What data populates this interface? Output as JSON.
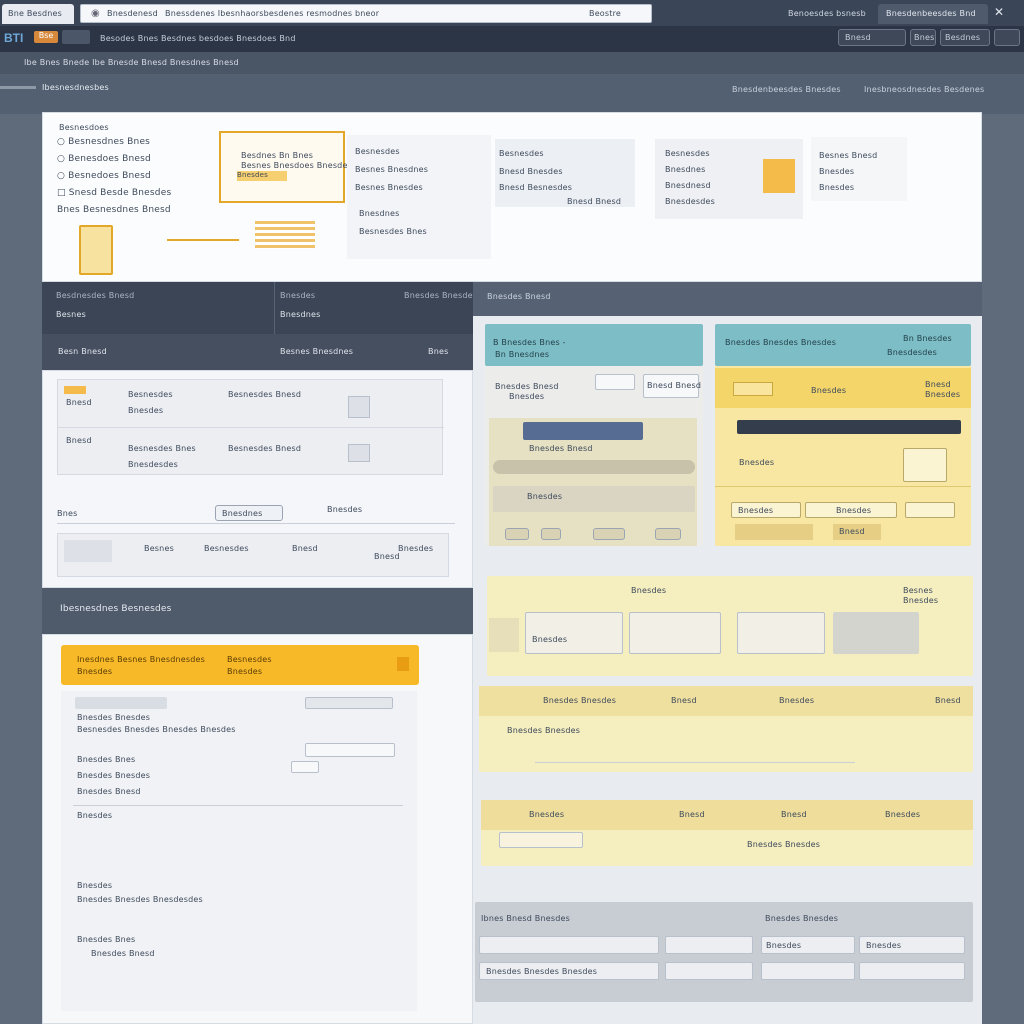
{
  "browser": {
    "tab1": "Bne Besdnes",
    "tab2": "Bnesdenesd",
    "address": "Bnessdenes Ibesnhaorsbesdenes resmodnes bneor",
    "address_btn": "Beostre",
    "right_tab": "Benoesdes bsnesb",
    "right_tab2": "Bnesdenbeesdes Bnd"
  },
  "menu": {
    "logo": "BTI",
    "badge": "Bse",
    "items": "Besodes Bnes Besdnes besdoes Bnesdoes Bnd",
    "right_btn1": "Bnesd",
    "right_btn2": "Bnes",
    "right_btn3": "Besdnes"
  },
  "subbar": {
    "text": "Ibe Bnes Bnede Ibe Bnesde Bnesd Bnesdnes Bnesd"
  },
  "pagebar": {
    "title": "Ibesnesdnesbes",
    "right1": "Bnesdenbeesdes Bnesdes",
    "right2": "Inesbneosdnesdes Besdenes"
  },
  "hero": {
    "list_title": "Besnesdoes",
    "list": [
      "Besnesdnes Bnes",
      "Benesdoes Bnesd",
      "Besnedoes Bnesd",
      "Snesd Besde Bnesdes",
      "Bnes Besnesdnes Bnesd"
    ],
    "callout": [
      "Besdnes Bn Bnes",
      "Besnes Bnesdoes Bnesdes",
      "Bnesdes"
    ],
    "cols": [
      {
        "h": "Besnesdes",
        "rows": [
          "Besnes Bnesdnes",
          "Besnes Bnesdes",
          "Bnesdnes",
          "Besnesdes Bnes"
        ]
      },
      {
        "h": "Besnesdes",
        "rows": [
          "Bnesd Bnesdes",
          "Bnesd Besnesdes",
          "Bnesd Bnesd"
        ]
      },
      {
        "h": "Besnesdes",
        "rows": [
          "Bnesdnes",
          "Bnesdnesd",
          "Bnesdesdes"
        ]
      },
      {
        "h": "Besnes Bnesd",
        "rows": [
          "Bnesdes",
          "Bnesdes"
        ]
      }
    ]
  },
  "left": {
    "table_head": [
      "Besdnesdes Bnesd",
      "Bnesdes",
      "Bnesdes Bnesdes"
    ],
    "table_row1": [
      "Besnes",
      "Bnesdnes"
    ],
    "table_row2": [
      "Besn Bnesd",
      "Besnes Bnesdnes",
      "Bnes"
    ],
    "list_rows": [
      [
        "Bnesd",
        "Besnesdes",
        "Bnesdes"
      ],
      [
        "Bnesd",
        "Besnesdes Bnesd",
        "Bnesdes"
      ],
      [
        "Bnesd",
        "Besnesdes Bnes",
        "Bnesdesdes"
      ],
      [
        "Bnesd",
        "Besnesdes Bnesd",
        "Bnesdes"
      ]
    ],
    "pager_label": "Bnes",
    "pager_btn": "Bnesdnes",
    "pager_right": "Bnesdes",
    "summary": [
      "Besnes",
      "Bnesd",
      "Besnesdes",
      "Bnesd",
      "Bnesdes"
    ],
    "section_title": "Ibesnesdnes Besnesdes",
    "alert_title": "Inesdnes Besnes Bnesdnesdes",
    "alert_sub": "Bnesdes",
    "alert_right": "Besnesdes",
    "alert_right2": "Bnesdes",
    "form_rows": [
      "Bnesdes Bnesdes",
      "Besnesdes Bnesdes Bnesdes Bnesdes",
      "Bnesdes Bnes",
      "Bnesdes Bnesdes",
      "Bnesdes Bnesd",
      "Bnesdes",
      "Bnesdes",
      "Bnesdes Bnesdes Bnesdesdes",
      "Bnesdes Bnes",
      "Bnesdes Bnesd"
    ]
  },
  "right": {
    "header": "Bnesdes Bnesd",
    "teal1_title": "B Bnesdes Bnes -",
    "teal1_sub": "Bn Bnesdnes",
    "teal2_title": "Bnesdes Bnesdes Bnesdes",
    "teal2_right": "Bn Bnesdes",
    "teal2_right2": "Bnesdesdes",
    "card1": [
      "Bnesdes Bnesd",
      "Bnesdes",
      "Bnesd Bnesd",
      "Bnesdes Bnesd",
      "Bnesdes"
    ],
    "card2": [
      "Bnesdes",
      "Bnesd",
      "Bnesdes",
      "Bnesdes",
      "Bnesdes",
      "Bnesdes"
    ],
    "card2_btns": [
      "Bnesdes",
      "Bnesdes",
      "Bnesd"
    ],
    "strip1": [
      "Bnesdes",
      "Besnes",
      "Bnesdes",
      "Bnesdes"
    ],
    "strip2": [
      "Bnesdes Bnesdes",
      "Bnesd",
      "Bnesdes",
      "Bnesd",
      "Bnesdes Bnesdes"
    ],
    "strip3": [
      "Bnesdes",
      "Bnesd",
      "Bnesd",
      "Bnesdes Bnesdes"
    ],
    "footer_left": "Ibnes Bnesd Bnesdes",
    "footer_right": "Bnesdes Bnesdes",
    "footer_fields": [
      "Bnesdes Bnesdes",
      "Bnesdes",
      "Bnesdes",
      "Bnesdes Bnesdes Bnesdes",
      "Bnesdes",
      "Bnesdes"
    ]
  }
}
